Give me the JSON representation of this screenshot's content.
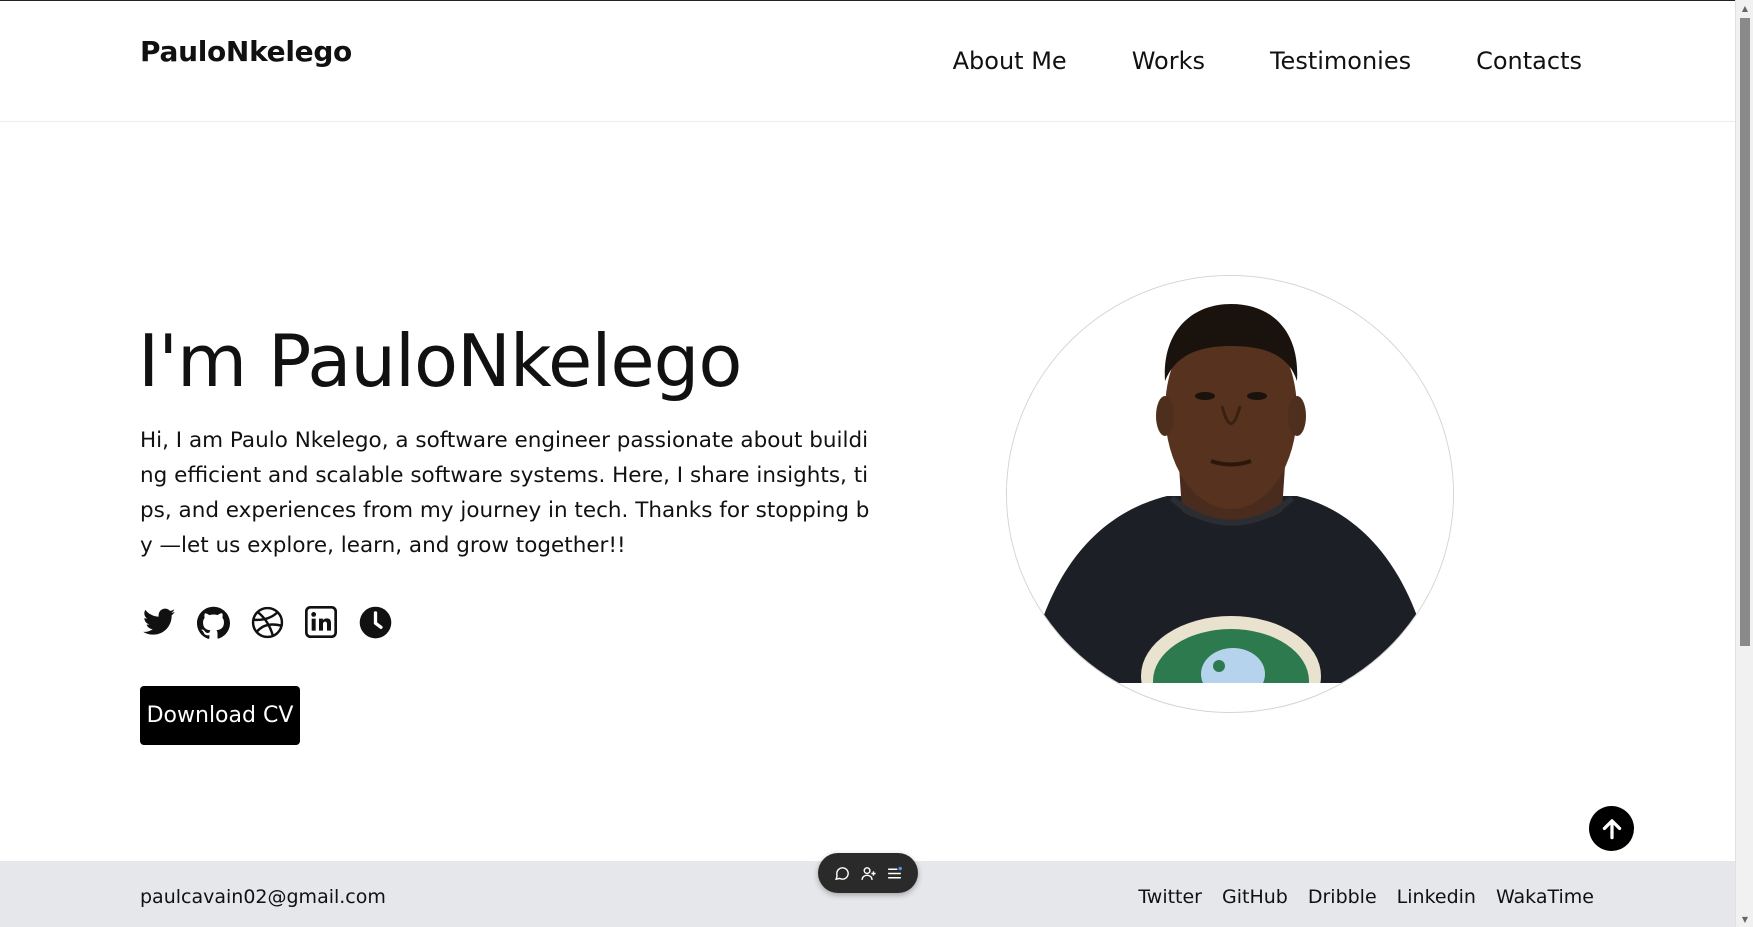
{
  "header": {
    "logo": "PauloNkelego",
    "nav": [
      "About Me",
      "Works",
      "Testimonies",
      "Contacts"
    ]
  },
  "hero": {
    "title": "I'm PauloNkelego",
    "description": "Hi, I am Paulo Nkelego, a software engineer passionate about building efficient and scalable software systems. Here, I share insights, tips, and experiences from my journey in tech. Thanks for stopping by —let us explore, learn, and grow together!!",
    "socials": [
      "twitter-icon",
      "github-icon",
      "dribbble-icon",
      "linkedin-icon",
      "wakatime-icon"
    ],
    "cv_button": "Download CV"
  },
  "footer": {
    "email": "paulcavain02@gmail.com",
    "links": [
      "Twitter",
      "GitHub",
      "Dribble",
      "Linkedin",
      "WakaTime"
    ]
  },
  "floating_toolbar": {
    "icons": [
      "chat-bubble-icon",
      "add-user-icon",
      "menu-list-icon"
    ]
  },
  "colors": {
    "accent": "#000000",
    "footer_bg": "#e5e7eb",
    "floating_bar_bg": "#2a2a2a"
  }
}
